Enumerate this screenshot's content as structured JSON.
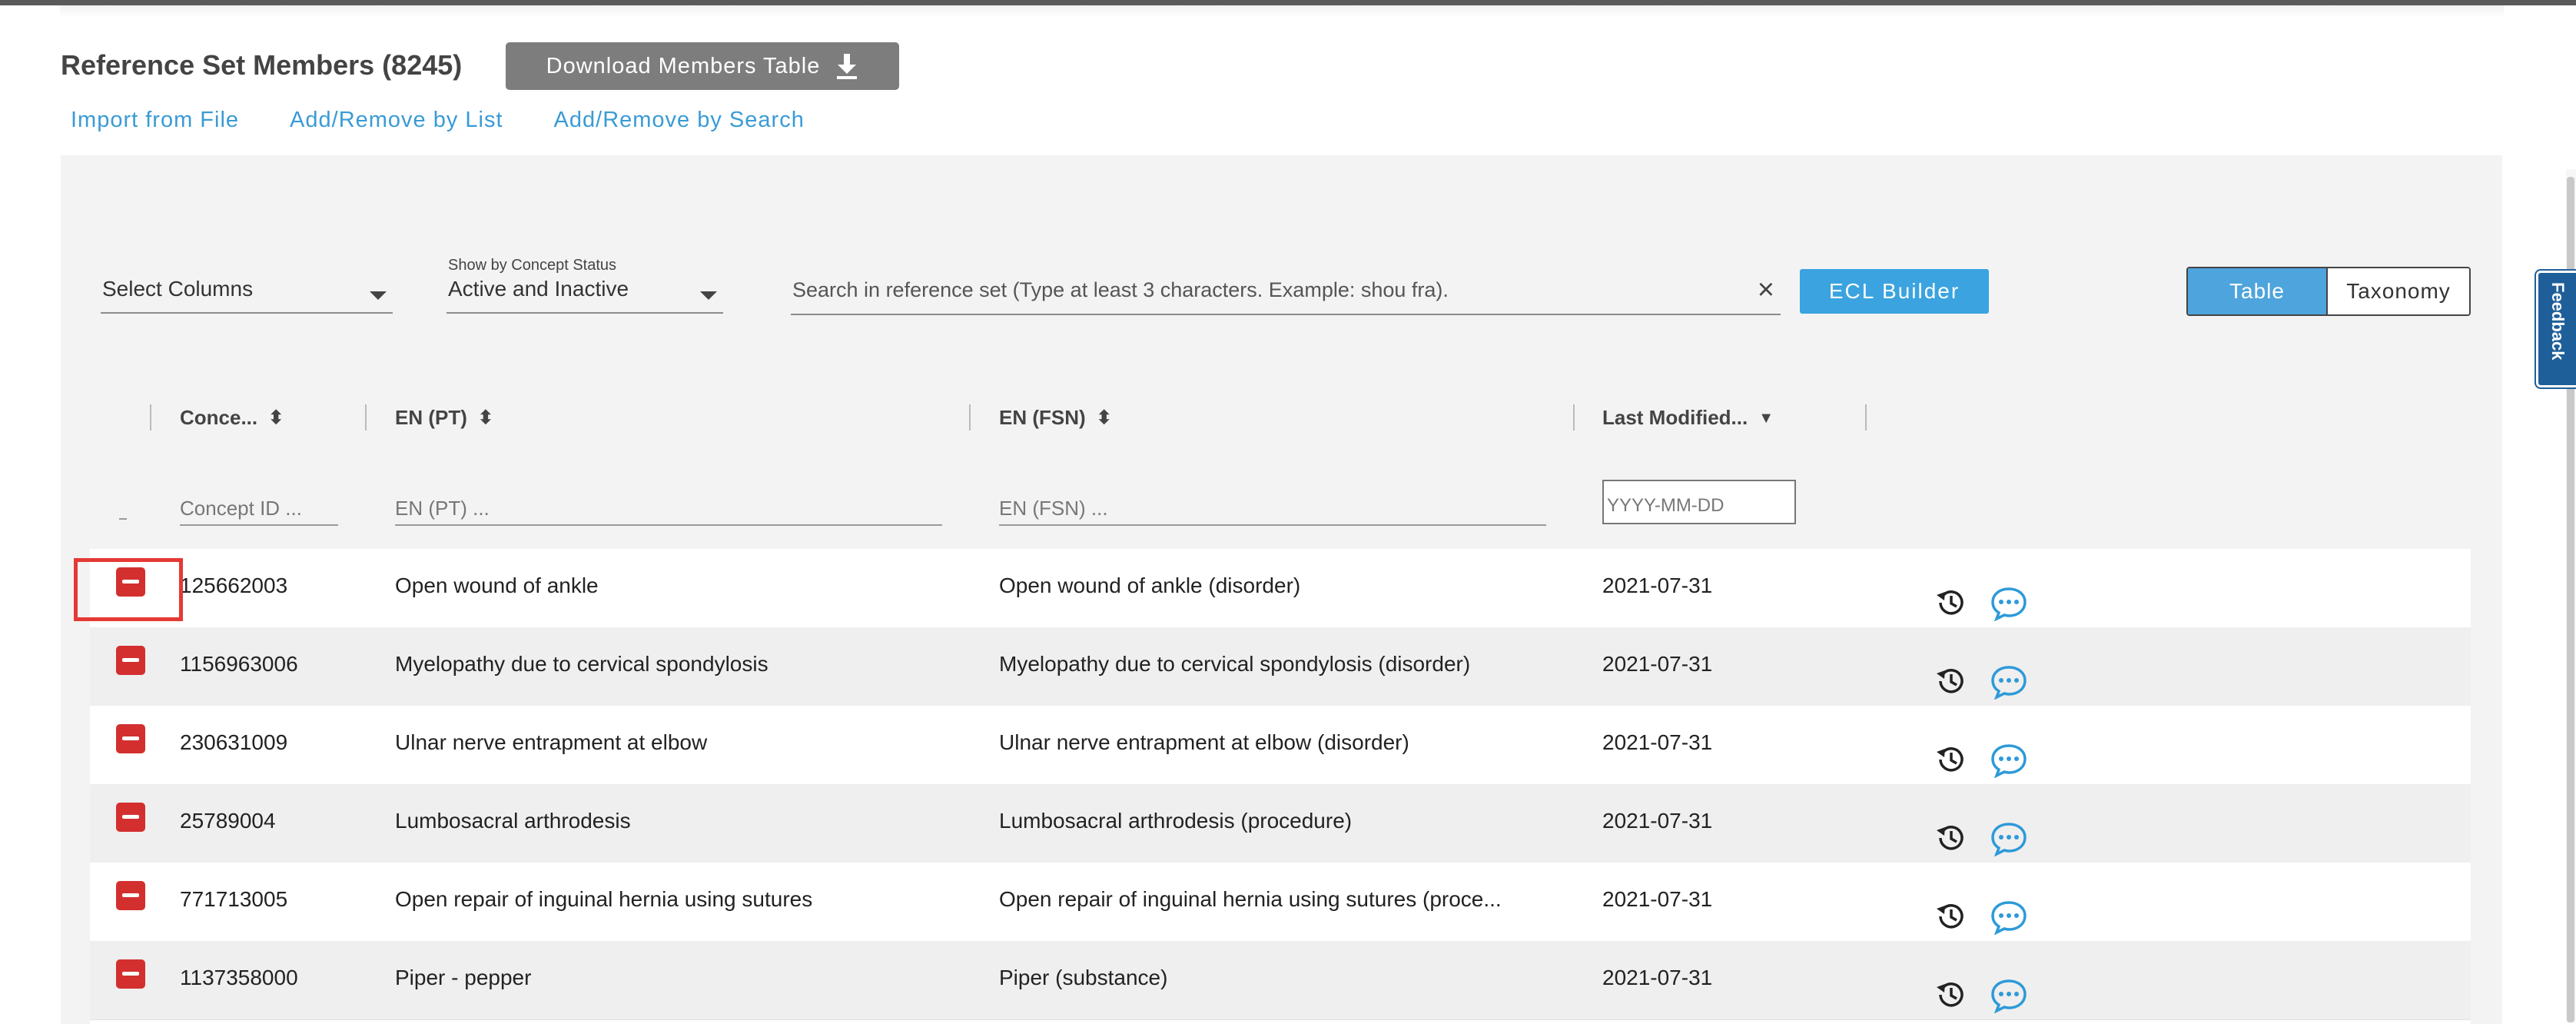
{
  "header": {
    "title": "Reference Set Members (8245)",
    "download_label": "Download Members Table"
  },
  "actions": [
    "Import from File",
    "Add/Remove by List",
    "Add/Remove by Search"
  ],
  "toolbar": {
    "select_columns": "Select Columns",
    "status_label": "Show by Concept Status",
    "status_value": "Active and Inactive",
    "search_placeholder": "Search in reference set (Type at least 3 characters. Example: shou fra).",
    "clear_icon": "×",
    "ecl_label": "ECL Builder",
    "view_table": "Table",
    "view_taxonomy": "Taxonomy"
  },
  "columns": {
    "concept": "Conce...",
    "pt": "EN (PT)",
    "fsn": "EN (FSN)",
    "modified": "Last Modified..."
  },
  "filters": {
    "concept_placeholder": "Concept ID ...",
    "pt_placeholder": "EN (PT) ...",
    "fsn_placeholder": "EN (FSN) ...",
    "date_placeholder": "YYYY-MM-DD"
  },
  "rows": [
    {
      "id": "125662003",
      "pt": "Open wound of ankle",
      "fsn": "Open wound of ankle (disorder)",
      "date": "2021-07-31"
    },
    {
      "id": "1156963006",
      "pt": "Myelopathy due to cervical spondylosis",
      "fsn": "Myelopathy due to cervical spondylosis (disorder)",
      "date": "2021-07-31"
    },
    {
      "id": "230631009",
      "pt": "Ulnar nerve entrapment at elbow",
      "fsn": "Ulnar nerve entrapment at elbow (disorder)",
      "date": "2021-07-31"
    },
    {
      "id": "25789004",
      "pt": "Lumbosacral arthrodesis",
      "fsn": "Lumbosacral arthrodesis (procedure)",
      "date": "2021-07-31"
    },
    {
      "id": "771713005",
      "pt": "Open repair of inguinal hernia using sutures",
      "fsn": "Open repair of inguinal hernia using sutures (proce...",
      "date": "2021-07-31"
    },
    {
      "id": "1137358000",
      "pt": "Piper - pepper",
      "fsn": "Piper (substance)",
      "date": "2021-07-31"
    }
  ],
  "feedback_label": "Feedback",
  "colors": {
    "accent": "#3aa3e0",
    "link": "#3a9bd5",
    "remove": "#d32f2f",
    "feedback": "#1f5f99"
  },
  "icons": [
    "download-icon",
    "sort-icon",
    "sort-desc-icon",
    "remove-icon",
    "history-icon",
    "comment-icon",
    "close-icon",
    "chevron-down-icon"
  ]
}
